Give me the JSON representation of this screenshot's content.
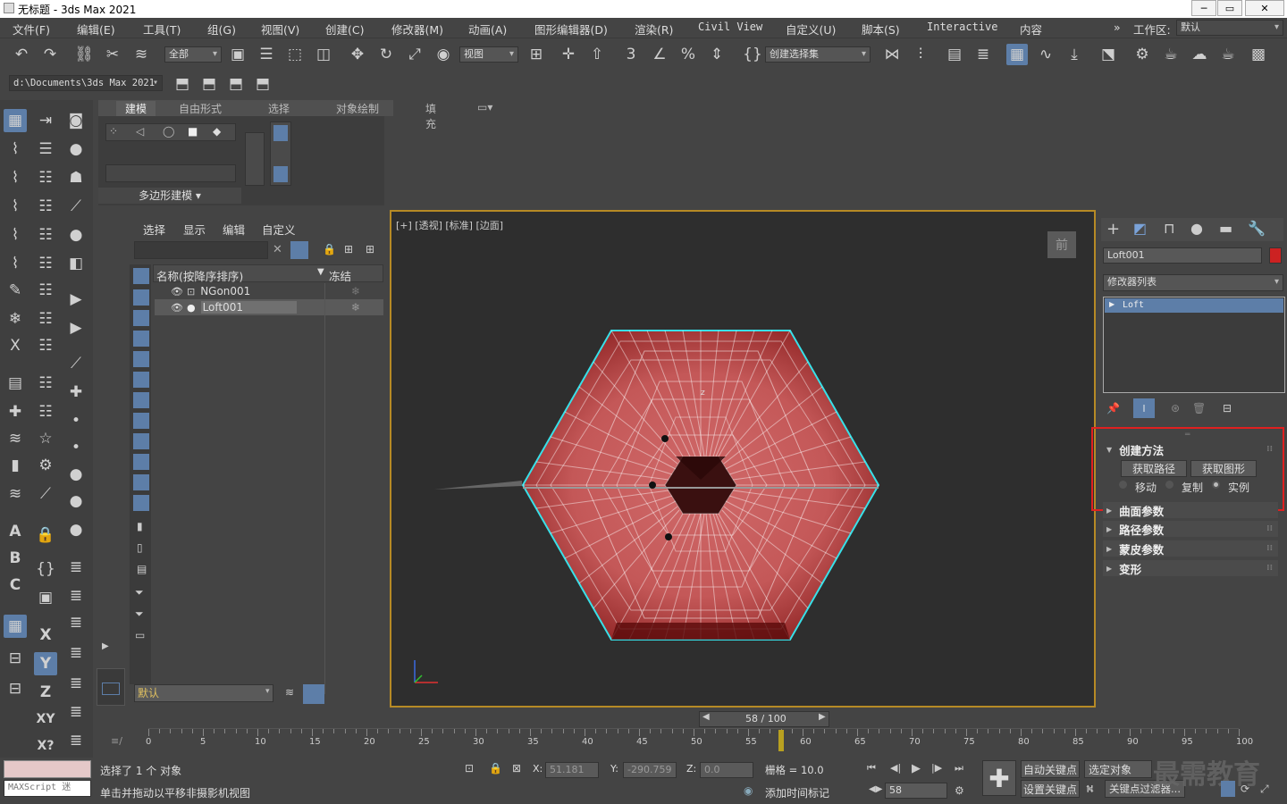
{
  "window": {
    "title": "无标题 - 3ds Max 2021",
    "min": "─",
    "max": "▭",
    "close": "✕"
  },
  "menu": [
    "文件(F)",
    "编辑(E)",
    "工具(T)",
    "组(G)",
    "视图(V)",
    "创建(C)",
    "修改器(M)",
    "动画(A)",
    "图形编辑器(D)",
    "渲染(R)",
    "Civil View",
    "自定义(U)",
    "脚本(S)",
    "Interactive",
    "内容"
  ],
  "workspace": {
    "label": "工作区:",
    "value": "默认"
  },
  "toolbar": {
    "selection_filter": "全部",
    "ref_coord": "视图",
    "named_selection": "创建选择集"
  },
  "project_path": "d:\\Documents\\3ds Max 2021",
  "ribbon": {
    "tabs": [
      "建模",
      "自由形式",
      "选择",
      "对象绘制",
      "填充"
    ],
    "panel_label": "多边形建模 ▾"
  },
  "scene_explorer": {
    "menus": [
      "选择",
      "显示",
      "编辑",
      "自定义"
    ],
    "col_name": "名称(按降序排序)",
    "col_freeze": "冻结",
    "rows": [
      {
        "name": "NGon001",
        "selected": false
      },
      {
        "name": "Loft001",
        "selected": true
      }
    ],
    "layer": "默认"
  },
  "viewport": {
    "label": "[+] [透视] [标准] [边面]",
    "viewcube": "前"
  },
  "command_panel": {
    "object_name": "Loft001",
    "object_color": "#cc2222",
    "modifier_list": "修改器列表",
    "stack_item": "Loft",
    "rollouts": {
      "creation_method": "创建方法",
      "get_path": "获取路径",
      "get_shape": "获取图形",
      "opt_move": "移动",
      "opt_copy": "复制",
      "opt_instance": "实例",
      "surface_params": "曲面参数",
      "path_params": "路径参数",
      "skin_params": "蒙皮参数",
      "deformation": "变形"
    }
  },
  "timeline": {
    "frame_display": "58 / 100",
    "current_frame": 58,
    "ticks": [
      "0",
      "5",
      "10",
      "15",
      "20",
      "25",
      "30",
      "35",
      "40",
      "45",
      "50",
      "55",
      "60",
      "65",
      "70",
      "75",
      "80",
      "85",
      "90",
      "95",
      "100"
    ]
  },
  "status": {
    "maxscript": "MAXScript 迷",
    "selected": "选择了 1 个 对象",
    "prompt": "单击并拖动以平移非摄影机视图",
    "x_label": "X:",
    "x": "51.181",
    "y_label": "Y:",
    "y": "-290.759",
    "z_label": "Z:",
    "z": "0.0",
    "grid": "栅格 = 10.0",
    "add_time_tag": "添加时间标记",
    "auto_key": "自动关键点",
    "selected_obj": "选定对象",
    "set_key": "设置关键点",
    "key_filters": "关键点过滤器...",
    "frame": "58",
    "watermark": "最需教育"
  },
  "colors": {
    "accent": "#5d7ea8",
    "highlight_box": "#e02020",
    "viewport_border": "#b68a25",
    "mesh": "#c85050"
  }
}
